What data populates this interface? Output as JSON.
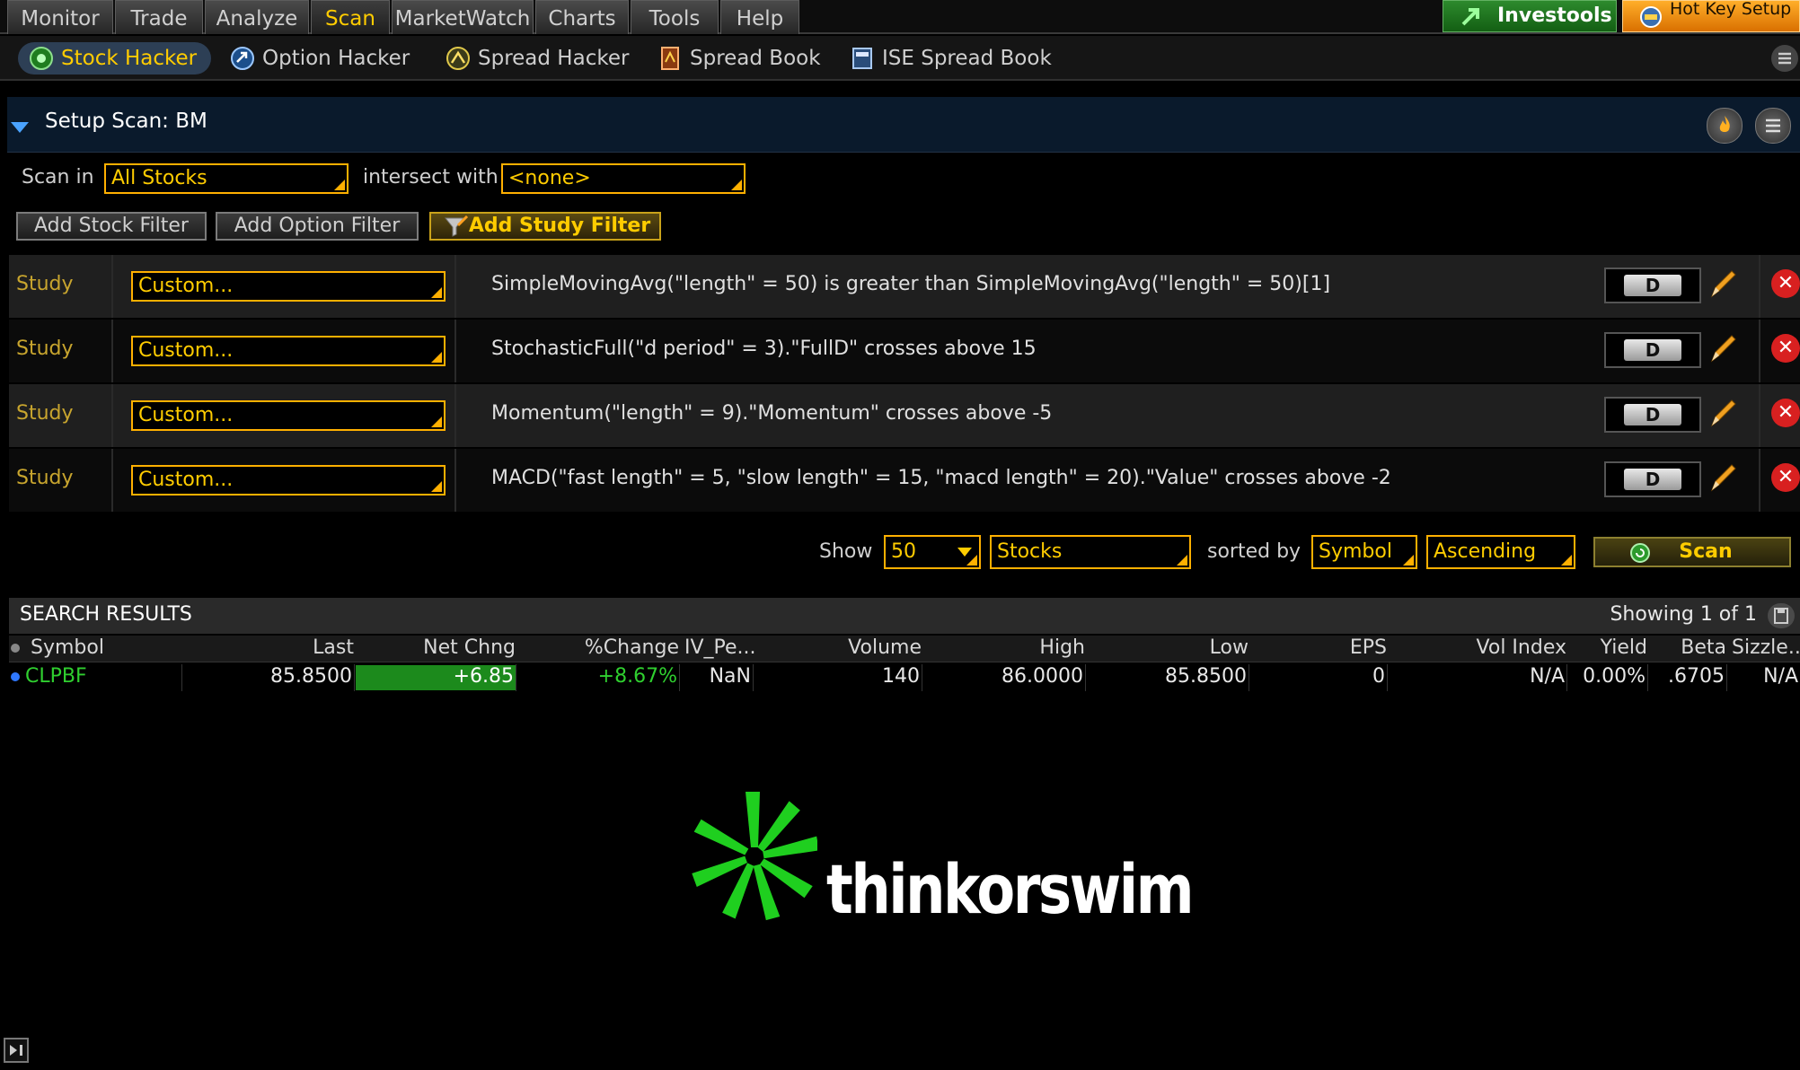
{
  "main_tabs": [
    {
      "label": "Monitor",
      "active": false
    },
    {
      "label": "Trade",
      "active": false
    },
    {
      "label": "Analyze",
      "active": false
    },
    {
      "label": "Scan",
      "active": true
    },
    {
      "label": "MarketWatch",
      "active": false
    },
    {
      "label": "Charts",
      "active": false
    },
    {
      "label": "Tools",
      "active": false
    },
    {
      "label": "Help",
      "active": false
    }
  ],
  "top_tools": {
    "investools": "Investools",
    "hotkey": "Hot Key Setup"
  },
  "sub_tabs": [
    {
      "label": "Stock Hacker",
      "icon": "stock-hacker-icon",
      "active": true
    },
    {
      "label": "Option Hacker",
      "icon": "option-hacker-icon",
      "active": false
    },
    {
      "label": "Spread Hacker",
      "icon": "spread-hacker-icon",
      "active": false
    },
    {
      "label": "Spread Book",
      "icon": "spread-book-icon",
      "active": false
    },
    {
      "label": "ISE Spread Book",
      "icon": "ise-spread-book-icon",
      "active": false
    }
  ],
  "setup": {
    "title": "Setup Scan: BM",
    "scan_in_label": "Scan in",
    "scan_in_value": "All Stocks",
    "intersect_label": "intersect with",
    "intersect_value": "<none>",
    "add_stock_filter": "Add Stock Filter",
    "add_option_filter": "Add Option Filter",
    "add_study_filter": "Add Study Filter"
  },
  "filters": [
    {
      "type": "Study",
      "combo": "Custom...",
      "condition": "SimpleMovingAvg(\"length\" = 50) is greater than SimpleMovingAvg(\"length\" = 50)[1]",
      "agg": "D"
    },
    {
      "type": "Study",
      "combo": "Custom...",
      "condition": "StochasticFull(\"d period\" = 3).\"FullD\" crosses above 15",
      "agg": "D"
    },
    {
      "type": "Study",
      "combo": "Custom...",
      "condition": "Momentum(\"length\" = 9).\"Momentum\" crosses above -5",
      "agg": "D"
    },
    {
      "type": "Study",
      "combo": "Custom...",
      "condition": "MACD(\"fast length\" = 5, \"slow length\" = 15, \"macd length\" = 20).\"Value\" crosses above -2",
      "agg": "D"
    }
  ],
  "scan_bar": {
    "show_label": "Show",
    "show_count": "50",
    "show_type": "Stocks",
    "sorted_by_label": "sorted by",
    "sort_field": "Symbol",
    "sort_order": "Ascending",
    "scan_button": "Scan"
  },
  "results": {
    "title": "SEARCH RESULTS",
    "showing": "Showing 1 of 1",
    "columns": [
      "Symbol",
      "Last",
      "Net Chng",
      "%Change",
      "IV_Pe...",
      "Volume",
      "High",
      "Low",
      "EPS",
      "Vol Index",
      "Yield",
      "Beta",
      "Sizzle..."
    ],
    "rows": [
      {
        "symbol": "CLPBF",
        "last": "85.8500",
        "net_chng": "+6.85",
        "pct_change": "+8.67%",
        "iv": "NaN",
        "volume": "140",
        "high": "86.0000",
        "low": "85.8500",
        "eps": "0",
        "vol_index": "N/A",
        "yield": "0.00%",
        "beta": ".6705",
        "sizzle": "N/A"
      }
    ]
  },
  "brand": "thinkorswim",
  "colors": {
    "accent": "#ffcc00",
    "positive": "#2fcf2f",
    "brand_green": "#1fcf1f",
    "header_bg": "#0a1a2c"
  }
}
